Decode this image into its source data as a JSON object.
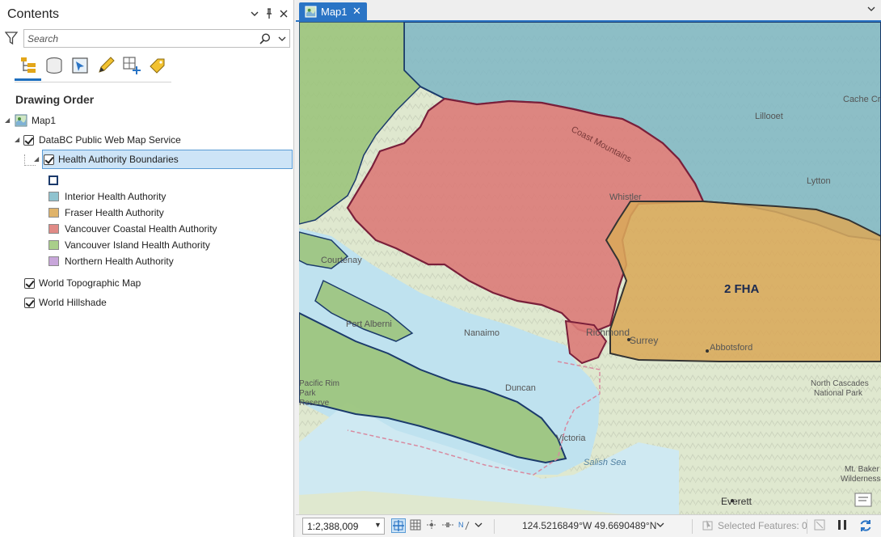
{
  "contents_pane": {
    "title": "Contents",
    "header_buttons": [
      "chevron-down-icon",
      "pin-icon",
      "close-icon"
    ],
    "search": {
      "placeholder": "Search"
    },
    "toolbar_icons": [
      "list-by-drawing-order-icon",
      "list-by-data-source-icon",
      "list-by-selection-icon",
      "list-by-editing-icon",
      "list-by-snapping-icon",
      "list-by-labeling-icon"
    ],
    "active_toolbar_index": 0,
    "section_label": "Drawing Order",
    "tree": {
      "map": "Map1",
      "service": "DataBC Public Web Map Service",
      "selected_layer": "Health Authority Boundaries",
      "legend": [
        {
          "label": "",
          "color": "#ffffff",
          "border": "#1b3a6b"
        },
        {
          "label": "Interior Health Authority",
          "color": "#8fc3cf"
        },
        {
          "label": "Fraser Health Authority",
          "color": "#dfb36a"
        },
        {
          "label": "Vancouver Coastal Health Authority",
          "color": "#e08a86"
        },
        {
          "label": "Vancouver Island Health Authority",
          "color": "#a9cf8a"
        },
        {
          "label": "Northern Health Authority",
          "color": "#c8a6da"
        }
      ],
      "other_layers": [
        "World Topographic Map",
        "World Hillshade"
      ]
    }
  },
  "map_pane": {
    "tab_label": "Map1",
    "place_labels": {
      "coast_mountains": "Coast Mountains",
      "cache_creek": "Cache Creek",
      "lillooet": "Lillooet",
      "lytton": "Lytton",
      "whistler": "Whistler",
      "courtenay": "Courtenay",
      "port_alberni": "Port Alberni",
      "nanaimo": "Nanaimo",
      "richmond": "Richmond",
      "surrey": "Surrey",
      "abbotsford": "Abbotsford",
      "duncan": "Duncan",
      "victoria": "Victoria",
      "salish_sea": "Salish Sea",
      "pacific_rim_1": "Pacific Rim",
      "pacific_rim_2": "Park",
      "pacific_rim_3": "Reserve",
      "north_cascades_1": "North Cascades",
      "north_cascades_2": "National Park",
      "mt_baker_1": "Mt. Baker",
      "mt_baker_2": "Wilderness",
      "everett": "Everett",
      "fha_label": "2 FHA"
    },
    "colors": {
      "interior": "#7fb6c4",
      "fraser": "#d9a95a",
      "coastal": "#dc7b78",
      "island": "#9cc47c",
      "water": "#bfe2ef",
      "border": "#7a1f3a",
      "accent": "#2a74c5"
    }
  },
  "status_bar": {
    "scale": "1:2,388,009",
    "coordinates": "124.5216849°W 49.6690489°N",
    "selected_features": "Selected Features: 0"
  }
}
